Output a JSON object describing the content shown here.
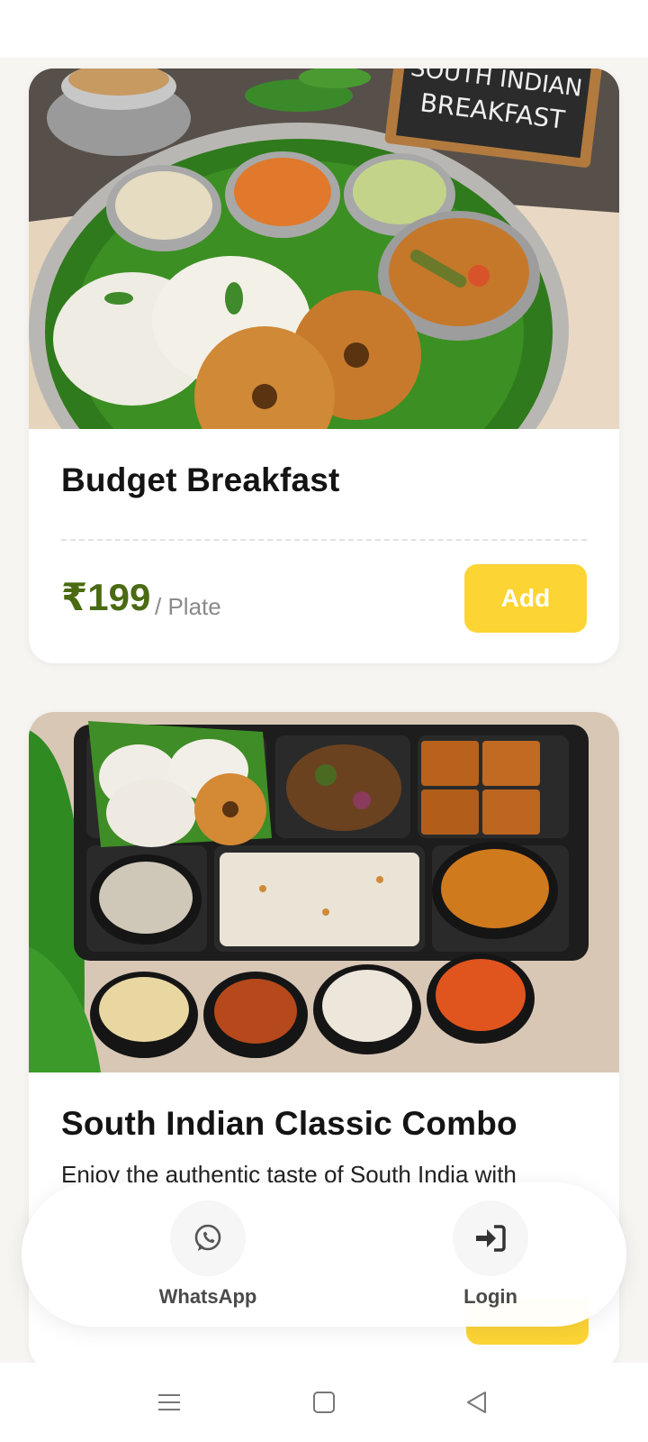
{
  "app": {
    "colors": {
      "accent": "#fcd535",
      "price": "#4a6b12",
      "background": "#f7f5f2"
    }
  },
  "products": [
    {
      "title": "Budget Breakfast",
      "price": "₹199",
      "unit": "/ Plate",
      "add_label": "Add",
      "image": {
        "sign_text_1": "SOUTH INDIAN",
        "sign_text_2": "BREAKFAST"
      }
    },
    {
      "title": "South Indian Classic Combo",
      "description": "Enjoy the authentic taste of South India with"
    }
  ],
  "dock": {
    "whatsapp": {
      "label": "WhatsApp",
      "icon": "whatsapp-icon"
    },
    "login": {
      "label": "Login",
      "icon": "login-icon"
    }
  },
  "system_nav": {
    "icons": [
      "menu-icon",
      "home-icon",
      "back-icon"
    ]
  }
}
